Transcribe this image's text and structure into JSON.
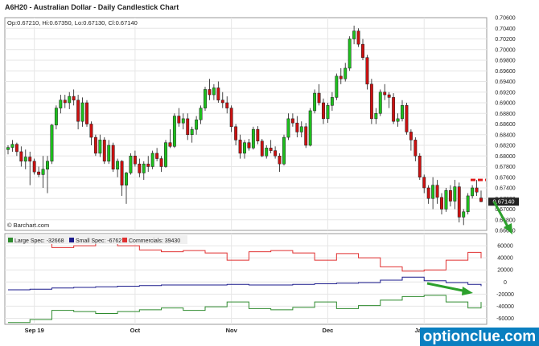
{
  "title": "A6H20 - Australian Dollar - Daily Candlestick Chart",
  "ohlc_label": "Op:0.67210, Hi:0.67350, Lo:0.67130, Cl:0.67140",
  "watermark": "© Barchart.com",
  "brand": "optionclue.com",
  "colors": {
    "up": "#1ec01e",
    "down": "#cc1111",
    "large_spec": "#2e8b2e",
    "small_spec": "#1a1a8c",
    "commercials": "#e03030",
    "arrow": "#2ca02c",
    "brand_bg": "#0a7fc0"
  },
  "chart_data": [
    {
      "type": "candlestick",
      "title": "A6H20 - Australian Dollar - Daily Candlestick Chart",
      "ylim": [
        0.666,
        0.706
      ],
      "y_ticks": [
        "0.66600",
        "0.66800",
        "0.67000",
        "0.67200",
        "0.67400",
        "0.67600",
        "0.67800",
        "0.68000",
        "0.68200",
        "0.68400",
        "0.68600",
        "0.68800",
        "0.69000",
        "0.69200",
        "0.69400",
        "0.69600",
        "0.69800",
        "0.70000",
        "0.70200",
        "0.70400",
        "0.70600"
      ],
      "x_ticks": [
        "Sep 19",
        "Oct",
        "Nov",
        "Dec",
        "Jan 20"
      ],
      "last_price": "0.67140",
      "resistance_level": 0.6755,
      "candles": [
        [
          0.6812,
          0.682,
          0.6803,
          0.6816
        ],
        [
          0.6816,
          0.683,
          0.6808,
          0.6822
        ],
        [
          0.6822,
          0.6825,
          0.68,
          0.6808
        ],
        [
          0.6808,
          0.6818,
          0.678,
          0.679
        ],
        [
          0.679,
          0.6812,
          0.6775,
          0.6798
        ],
        [
          0.6798,
          0.6808,
          0.6745,
          0.679
        ],
        [
          0.679,
          0.6795,
          0.6765,
          0.677
        ],
        [
          0.677,
          0.678,
          0.676,
          0.6765
        ],
        [
          0.6765,
          0.68,
          0.674,
          0.6775
        ],
        [
          0.6775,
          0.68,
          0.673,
          0.679
        ],
        [
          0.679,
          0.686,
          0.6785,
          0.6858
        ],
        [
          0.6858,
          0.6895,
          0.685,
          0.689
        ],
        [
          0.689,
          0.6915,
          0.688,
          0.6905
        ],
        [
          0.6905,
          0.6915,
          0.689,
          0.69
        ],
        [
          0.69,
          0.692,
          0.6888,
          0.6912
        ],
        [
          0.6912,
          0.6925,
          0.6895,
          0.6905
        ],
        [
          0.6905,
          0.6915,
          0.685,
          0.6865
        ],
        [
          0.6865,
          0.691,
          0.6855,
          0.69
        ],
        [
          0.69,
          0.6905,
          0.6855,
          0.686
        ],
        [
          0.686,
          0.6865,
          0.682,
          0.6835
        ],
        [
          0.6835,
          0.684,
          0.68,
          0.6805
        ],
        [
          0.6805,
          0.684,
          0.6798,
          0.683
        ],
        [
          0.683,
          0.6835,
          0.6785,
          0.679
        ],
        [
          0.679,
          0.683,
          0.6785,
          0.682
        ],
        [
          0.682,
          0.6825,
          0.677,
          0.6775
        ],
        [
          0.6775,
          0.6795,
          0.676,
          0.679
        ],
        [
          0.679,
          0.6792,
          0.6725,
          0.6745
        ],
        [
          0.6745,
          0.677,
          0.671,
          0.6768
        ],
        [
          0.6768,
          0.6805,
          0.6765,
          0.68
        ],
        [
          0.68,
          0.681,
          0.678,
          0.6785
        ],
        [
          0.6785,
          0.6795,
          0.676,
          0.6768
        ],
        [
          0.6768,
          0.679,
          0.6755,
          0.6785
        ],
        [
          0.6785,
          0.68,
          0.677,
          0.678
        ],
        [
          0.678,
          0.681,
          0.6775,
          0.6805
        ],
        [
          0.6805,
          0.6815,
          0.679,
          0.6795
        ],
        [
          0.6795,
          0.68,
          0.677,
          0.678
        ],
        [
          0.678,
          0.683,
          0.6778,
          0.6825
        ],
        [
          0.6825,
          0.685,
          0.6815,
          0.6818
        ],
        [
          0.6818,
          0.688,
          0.6815,
          0.6875
        ],
        [
          0.6875,
          0.689,
          0.6855,
          0.6862
        ],
        [
          0.6862,
          0.688,
          0.685,
          0.687
        ],
        [
          0.687,
          0.688,
          0.683,
          0.684
        ],
        [
          0.684,
          0.6855,
          0.6825,
          0.685
        ],
        [
          0.685,
          0.6875,
          0.684,
          0.6868
        ],
        [
          0.6868,
          0.6895,
          0.686,
          0.689
        ],
        [
          0.689,
          0.693,
          0.6885,
          0.6925
        ],
        [
          0.6925,
          0.6945,
          0.6905,
          0.6915
        ],
        [
          0.6915,
          0.6935,
          0.6905,
          0.6928
        ],
        [
          0.6928,
          0.694,
          0.69,
          0.6905
        ],
        [
          0.6905,
          0.692,
          0.689,
          0.69
        ],
        [
          0.69,
          0.6912,
          0.688,
          0.689
        ],
        [
          0.689,
          0.6895,
          0.6845,
          0.6855
        ],
        [
          0.6855,
          0.686,
          0.682,
          0.683
        ],
        [
          0.683,
          0.684,
          0.6795,
          0.6805
        ],
        [
          0.6805,
          0.683,
          0.6795,
          0.6825
        ],
        [
          0.6825,
          0.6832,
          0.681,
          0.6815
        ],
        [
          0.6815,
          0.6855,
          0.6812,
          0.685
        ],
        [
          0.685,
          0.6856,
          0.6822,
          0.6828
        ],
        [
          0.6828,
          0.6832,
          0.6798,
          0.68
        ],
        [
          0.68,
          0.682,
          0.6795,
          0.6815
        ],
        [
          0.6815,
          0.683,
          0.6805,
          0.681
        ],
        [
          0.681,
          0.6818,
          0.6795,
          0.68
        ],
        [
          0.68,
          0.6805,
          0.677,
          0.6785
        ],
        [
          0.6785,
          0.684,
          0.6782,
          0.6835
        ],
        [
          0.6835,
          0.688,
          0.683,
          0.687
        ],
        [
          0.687,
          0.688,
          0.6855,
          0.6862
        ],
        [
          0.6862,
          0.6875,
          0.6835,
          0.6845
        ],
        [
          0.6845,
          0.6865,
          0.6835,
          0.6855
        ],
        [
          0.6855,
          0.6862,
          0.6815,
          0.682
        ],
        [
          0.682,
          0.689,
          0.6818,
          0.6885
        ],
        [
          0.6885,
          0.6925,
          0.688,
          0.6918
        ],
        [
          0.6918,
          0.6935,
          0.6895,
          0.69
        ],
        [
          0.69,
          0.6908,
          0.686,
          0.687
        ],
        [
          0.687,
          0.69,
          0.6862,
          0.6895
        ],
        [
          0.6895,
          0.692,
          0.6885,
          0.691
        ],
        [
          0.691,
          0.6955,
          0.6905,
          0.695
        ],
        [
          0.695,
          0.6965,
          0.6935,
          0.6945
        ],
        [
          0.6945,
          0.6975,
          0.694,
          0.6965
        ],
        [
          0.6965,
          0.7025,
          0.696,
          0.702
        ],
        [
          0.702,
          0.7045,
          0.701,
          0.7035
        ],
        [
          0.7035,
          0.704,
          0.7005,
          0.701
        ],
        [
          0.701,
          0.702,
          0.698,
          0.6985
        ],
        [
          0.6985,
          0.699,
          0.6925,
          0.6935
        ],
        [
          0.6935,
          0.6945,
          0.686,
          0.687
        ],
        [
          0.687,
          0.689,
          0.686,
          0.688
        ],
        [
          0.688,
          0.6925,
          0.6875,
          0.692
        ],
        [
          0.692,
          0.6935,
          0.6905,
          0.6915
        ],
        [
          0.6915,
          0.692,
          0.689,
          0.691
        ],
        [
          0.691,
          0.6918,
          0.686,
          0.6865
        ],
        [
          0.6865,
          0.688,
          0.6855,
          0.687
        ],
        [
          0.687,
          0.6905,
          0.6865,
          0.6895
        ],
        [
          0.6895,
          0.69,
          0.684,
          0.6845
        ],
        [
          0.6845,
          0.685,
          0.681,
          0.683
        ],
        [
          0.683,
          0.6835,
          0.679,
          0.68
        ],
        [
          0.68,
          0.6805,
          0.6755,
          0.676
        ],
        [
          0.676,
          0.6765,
          0.673,
          0.674
        ],
        [
          0.674,
          0.6745,
          0.671,
          0.672
        ],
        [
          0.672,
          0.676,
          0.67,
          0.6745
        ],
        [
          0.6745,
          0.6755,
          0.671,
          0.6722
        ],
        [
          0.6722,
          0.673,
          0.669,
          0.67
        ],
        [
          0.67,
          0.674,
          0.6695,
          0.6735
        ],
        [
          0.6735,
          0.6745,
          0.6705,
          0.6715
        ],
        [
          0.6715,
          0.6755,
          0.67,
          0.6742
        ],
        [
          0.6742,
          0.675,
          0.6675,
          0.6685
        ],
        [
          0.6685,
          0.67,
          0.667,
          0.6695
        ],
        [
          0.6695,
          0.673,
          0.669,
          0.6725
        ],
        [
          0.6725,
          0.6745,
          0.672,
          0.674
        ],
        [
          0.674,
          0.6755,
          0.6725,
          0.6732
        ],
        [
          0.6721,
          0.6735,
          0.6713,
          0.6714
        ]
      ]
    },
    {
      "type": "line",
      "title": "COT",
      "ylim": [
        -70000,
        80000
      ],
      "y_ticks": [
        "60000",
        "40000",
        "20000",
        "0",
        "-20000",
        "-40000",
        "-60000"
      ],
      "series": [
        {
          "name": "Large Spec: -32668",
          "color": "#2e8b2e",
          "values": [
            -67000,
            -67000,
            -67000,
            -67000,
            -67000,
            -62000,
            -62000,
            -62000,
            -62000,
            -62000,
            -47000,
            -47000,
            -47000,
            -47000,
            -47000,
            -49000,
            -49000,
            -49000,
            -49000,
            -49000,
            -52000,
            -52000,
            -52000,
            -52000,
            -52000,
            -49000,
            -49000,
            -49000,
            -49000,
            -49000,
            -46000,
            -46000,
            -46000,
            -46000,
            -46000,
            -43000,
            -43000,
            -43000,
            -43000,
            -43000,
            -47000,
            -47000,
            -47000,
            -47000,
            -47000,
            -41000,
            -41000,
            -41000,
            -41000,
            -41000,
            -33000,
            -33000,
            -33000,
            -33000,
            -33000,
            -44000,
            -44000,
            -44000,
            -44000,
            -44000,
            -46000,
            -46000,
            -46000,
            -46000,
            -46000,
            -42000,
            -42000,
            -42000,
            -42000,
            -42000,
            -33000,
            -33000,
            -33000,
            -33000,
            -33000,
            -44000,
            -44000,
            -44000,
            -44000,
            -44000,
            -39000,
            -39000,
            -39000,
            -39000,
            -39000,
            -30000,
            -30000,
            -30000,
            -30000,
            -30000,
            -24000,
            -24000,
            -24000,
            -24000,
            -24000,
            -22000,
            -22000,
            -22000,
            -22000,
            -22000,
            -33000,
            -33000,
            -33000,
            -33000,
            -33000,
            -43000,
            -43000,
            -43000,
            -33000
          ]
        },
        {
          "name": "Small Spec: -6762",
          "color": "#1a1a8c",
          "values": [
            -13000,
            -13000,
            -13000,
            -13000,
            -13000,
            -12000,
            -12000,
            -12000,
            -12000,
            -12000,
            -10000,
            -10000,
            -10000,
            -10000,
            -10000,
            -9000,
            -9000,
            -9000,
            -9000,
            -9000,
            -8000,
            -8000,
            -8000,
            -8000,
            -8000,
            -7000,
            -7000,
            -7000,
            -7000,
            -7000,
            -6000,
            -6000,
            -6000,
            -6000,
            -6000,
            -5000,
            -5000,
            -5000,
            -5000,
            -5000,
            -5000,
            -5000,
            -5000,
            -5000,
            -5000,
            -5000,
            -5000,
            -5000,
            -5000,
            -5000,
            -4000,
            -4000,
            -4000,
            -4000,
            -4000,
            -5000,
            -5000,
            -5000,
            -5000,
            -5000,
            -5000,
            -5000,
            -5000,
            -5000,
            -5000,
            -4000,
            -4000,
            -4000,
            -4000,
            -4000,
            -3000,
            -3000,
            -3000,
            -3000,
            -3000,
            -2000,
            -2000,
            -2000,
            -2000,
            -2000,
            -1000,
            -1000,
            -1000,
            -1000,
            -1000,
            3000,
            3000,
            3000,
            3000,
            3000,
            8000,
            8000,
            8000,
            8000,
            8000,
            2000,
            2000,
            2000,
            2000,
            2000,
            -1000,
            -1000,
            -1000,
            -1000,
            -1000,
            -4000,
            -4000,
            -4000,
            -6762
          ]
        },
        {
          "name": "Commercials: 39430",
          "color": "#e03030",
          "values": [
            75000,
            75000,
            75000,
            75000,
            75000,
            68000,
            68000,
            68000,
            68000,
            68000,
            57000,
            57000,
            57000,
            57000,
            57000,
            60000,
            60000,
            60000,
            60000,
            60000,
            64000,
            64000,
            64000,
            64000,
            64000,
            60000,
            60000,
            60000,
            60000,
            60000,
            53000,
            53000,
            53000,
            53000,
            53000,
            50000,
            50000,
            50000,
            50000,
            50000,
            52000,
            52000,
            52000,
            52000,
            52000,
            48000,
            48000,
            48000,
            48000,
            48000,
            36000,
            36000,
            36000,
            36000,
            36000,
            50000,
            50000,
            50000,
            50000,
            50000,
            52000,
            52000,
            52000,
            52000,
            52000,
            48000,
            48000,
            48000,
            48000,
            48000,
            36000,
            36000,
            36000,
            36000,
            36000,
            47000,
            47000,
            47000,
            47000,
            47000,
            40000,
            40000,
            40000,
            40000,
            40000,
            25000,
            25000,
            25000,
            25000,
            25000,
            18000,
            18000,
            18000,
            18000,
            18000,
            20000,
            20000,
            20000,
            20000,
            20000,
            36000,
            36000,
            36000,
            36000,
            36000,
            49000,
            49000,
            49000,
            39430
          ]
        }
      ]
    }
  ]
}
